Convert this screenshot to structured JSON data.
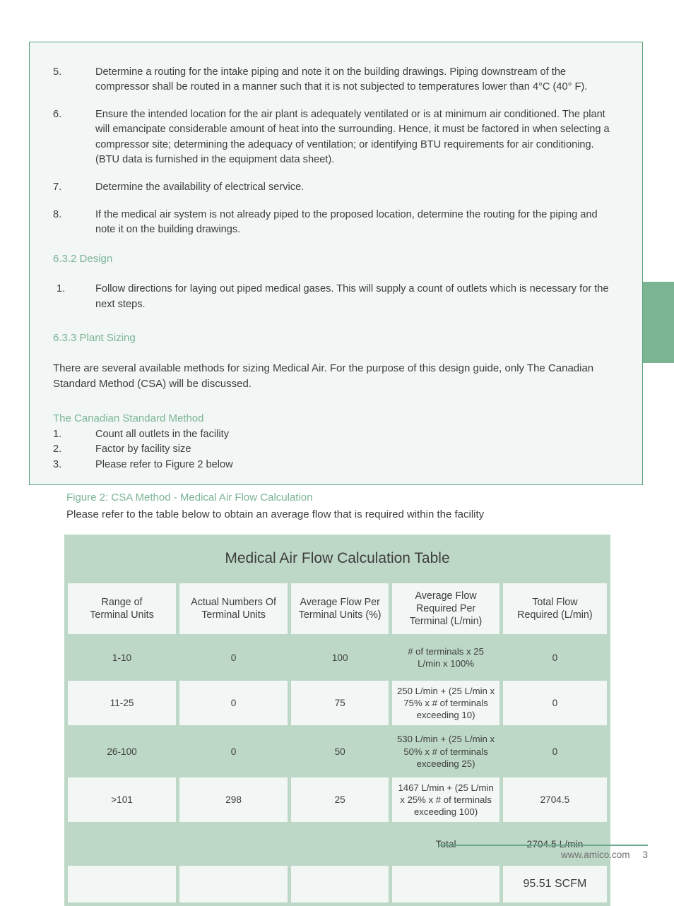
{
  "panel": {
    "numbered_items": [
      {
        "num": "5.",
        "text": "Determine a routing for the intake piping and note it on the building drawings. Piping downstream of the compressor shall be routed in a manner such that it is not subjected to temperatures lower than 4°C (40° F)."
      },
      {
        "num": "6.",
        "text": "Ensure the intended location for the air plant is adequately ventilated or is at minimum air conditioned. The plant will emancipate considerable amount of heat into the surrounding. Hence, it must be factored in when selecting a compressor site; determining the adequacy of ventilation; or identifying BTU requirements for air conditioning. (BTU data is furnished in the equipment data sheet)."
      },
      {
        "num": "7.",
        "text": "Determine the availability of electrical service."
      },
      {
        "num": "8.",
        "text": "If the medical air system is not already piped to the proposed location, determine the routing for the piping and note it on the building drawings."
      }
    ],
    "design_heading": "6.3.2 Design",
    "design_item": {
      "num": "1.",
      "text": "Follow directions for laying out piped medical gases. This will supply a count of outlets which is necessary for the next steps."
    },
    "plant_sizing_heading": "6.3.3 Plant Sizing",
    "plant_sizing_paragraph": "There are several available methods for sizing Medical Air. For the purpose of this design guide, only The Canadian Standard Method (CSA) will be discussed.",
    "csm_heading": "The Canadian Standard Method",
    "csm_items": [
      {
        "num": "1.",
        "text": "Count all outlets in the facility"
      },
      {
        "num": "2.",
        "text": "Factor by facility size"
      },
      {
        "num": "3.",
        "text": "Please refer to Figure 2 below"
      }
    ]
  },
  "figure": {
    "title": "Figure 2: CSA Method - Medical Air Flow Calculation",
    "subtitle": "Please refer to the table below to obtain an average flow that is required within the facility"
  },
  "chart_data": {
    "type": "table",
    "title": "Medical Air Flow Calculation Table",
    "columns": [
      "Range of Terminal Units",
      "Actual Numbers Of Terminal Units",
      "Average Flow Per Terminal Units (%)",
      "Average Flow Required Per Terminal (L/min)",
      "Total Flow Required (L/min)"
    ],
    "rows": [
      {
        "shaded": true,
        "range": "1-10",
        "actual": "0",
        "pct": "100",
        "formula": "# of terminals x 25 L/min x 100%",
        "total": "0"
      },
      {
        "shaded": false,
        "range": "11-25",
        "actual": "0",
        "pct": "75",
        "formula": "250 L/min + (25 L/min x 75% x # of terminals exceeding 10)",
        "total": "0"
      },
      {
        "shaded": true,
        "range": "26-100",
        "actual": "0",
        "pct": "50",
        "formula": "530 L/min + (25 L/min x 50% x # of terminals exceeding 25)",
        "total": "0"
      },
      {
        "shaded": false,
        "range": ">101",
        "actual": "298",
        "pct": "25",
        "formula": "1467 L/min + (25 L/min x 25% x # of terminals exceeding 100)",
        "total": "2704.5"
      }
    ],
    "summary_row": {
      "shaded": true,
      "label": "Total",
      "value": "2704.5 L/min"
    },
    "conversion_row": {
      "shaded": false,
      "value": "95.51 SCFM"
    }
  },
  "header_labels": {
    "col1_line1": "Range of",
    "col1_line2": "Terminal Units",
    "col2_line1": "Actual Numbers Of",
    "col2_line2": "Terminal Units",
    "col3_line1": "Average Flow Per",
    "col3_line2": "Terminal Units (%)",
    "col4_line1": "Average Flow",
    "col4_line2": "Required Per",
    "col4_line3": "Terminal (L/min)",
    "col5_line1": "Total Flow",
    "col5_line2": "Required (L/min)"
  },
  "footer": {
    "website": "www.amico.com",
    "page_number": "3"
  },
  "colors": {
    "accent_green": "#7bb494",
    "panel_border": "#5aa27a",
    "panel_bg": "#f2f6f5",
    "table_green": "#bed8c8",
    "tab_green": "#7cb593"
  }
}
